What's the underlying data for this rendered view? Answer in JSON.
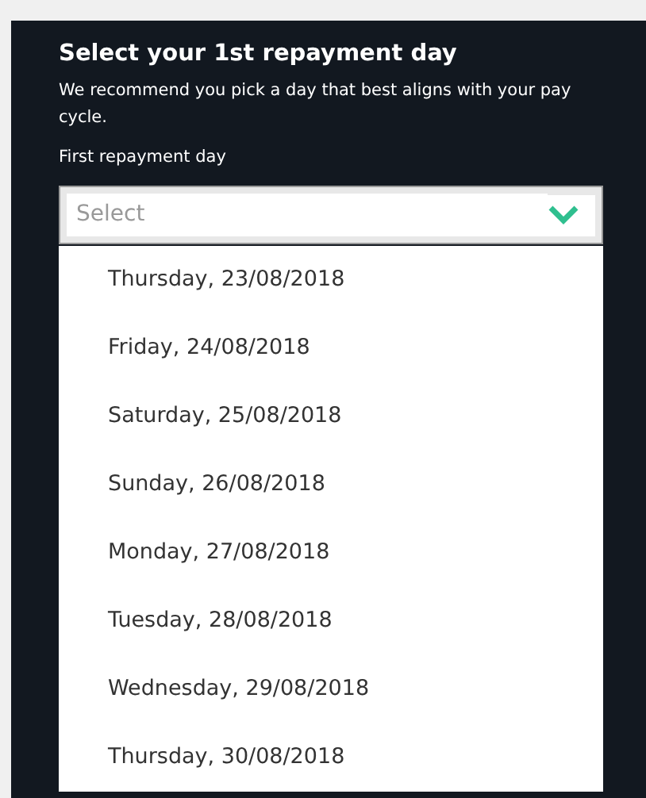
{
  "title": "Select your 1st repayment day",
  "description": "We recommend you pick a day that best aligns with your pay cycle.",
  "field": {
    "label": "First repayment day",
    "placeholder": "Select",
    "expanded": true
  },
  "options": [
    {
      "label": "Thursday, 23/08/2018"
    },
    {
      "label": "Friday, 24/08/2018"
    },
    {
      "label": "Saturday, 25/08/2018"
    },
    {
      "label": "Sunday, 26/08/2018"
    },
    {
      "label": "Monday, 27/08/2018"
    },
    {
      "label": "Tuesday, 28/08/2018"
    },
    {
      "label": "Wednesday, 29/08/2018"
    },
    {
      "label": "Thursday, 30/08/2018"
    }
  ]
}
